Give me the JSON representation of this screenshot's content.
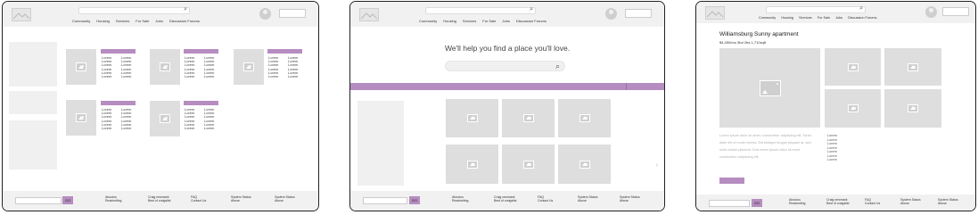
{
  "nav": [
    "Community",
    "Housing",
    "Services",
    "For Sale",
    "Jobs",
    "Discussion Forums"
  ],
  "search_icon": "magnifier",
  "footer": {
    "button_label": "GO",
    "col1": [
      "Aboutus",
      "Readwriting"
    ],
    "col2": [
      "Craig newmark",
      "Best of craigslist"
    ],
    "col3": [
      "FAQ",
      "Contact Us"
    ],
    "col4": [
      "System Status",
      "Abuse"
    ]
  },
  "listing_text": "Lorem",
  "page2": {
    "tagline": "We'll help  you find a place  you'll love."
  },
  "page3": {
    "title": "Williamsburg Sunny apartment",
    "subtitle": "$4,450/mo  3bd  2ba  1,710sqft",
    "description": "Lorem ipsum dolor sit amet, consectetur adipiscing elit. Tortor diam elit ut morbi viverra. Est tristique feugiat aliquam at, sed nulla nullam placerat. Duis lorem ipsum dolor sit amet, consectetur adipiscing elit.",
    "list": [
      "Lorem",
      "Lorem",
      "Lorem",
      "Lorem",
      "Lorem",
      "Lorem",
      "Lorem"
    ]
  },
  "colors": {
    "accent": "#b68dc0",
    "header": "#f1f1f1",
    "placeholder": "#dedede"
  }
}
